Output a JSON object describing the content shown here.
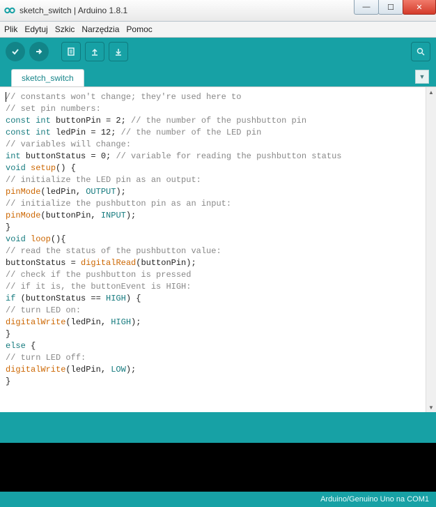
{
  "window": {
    "title": "sketch_switch | Arduino 1.8.1"
  },
  "menu": {
    "items": [
      "Plik",
      "Edytuj",
      "Szkic",
      "Narzędzia",
      "Pomoc"
    ]
  },
  "tab": {
    "name": "sketch_switch"
  },
  "code": {
    "lines": [
      {
        "t": "comment",
        "text": "// constants won't change; they're used here to"
      },
      {
        "t": "comment",
        "text": "// set pin numbers:"
      },
      {
        "t": "mixed",
        "parts": [
          {
            "c": "kw",
            "s": "const int"
          },
          {
            "c": "",
            "s": " buttonPin = 2; "
          },
          {
            "c": "comment",
            "s": "// the number of the pushbutton pin"
          }
        ]
      },
      {
        "t": "mixed",
        "parts": [
          {
            "c": "kw",
            "s": "const int"
          },
          {
            "c": "",
            "s": " ledPin = 12; "
          },
          {
            "c": "comment",
            "s": "// the number of the LED pin"
          }
        ]
      },
      {
        "t": "comment",
        "text": "// variables will change:"
      },
      {
        "t": "mixed",
        "parts": [
          {
            "c": "kw",
            "s": "int"
          },
          {
            "c": "",
            "s": " buttonStatus = 0; "
          },
          {
            "c": "comment",
            "s": "// variable for reading the pushbutton status"
          }
        ]
      },
      {
        "t": "mixed",
        "parts": [
          {
            "c": "kw",
            "s": "void"
          },
          {
            "c": "",
            "s": " "
          },
          {
            "c": "func",
            "s": "setup"
          },
          {
            "c": "",
            "s": "() {"
          }
        ]
      },
      {
        "t": "comment",
        "text": "// initialize the LED pin as an output:"
      },
      {
        "t": "mixed",
        "parts": [
          {
            "c": "func",
            "s": "pinMode"
          },
          {
            "c": "",
            "s": "(ledPin, "
          },
          {
            "c": "const",
            "s": "OUTPUT"
          },
          {
            "c": "",
            "s": ");"
          }
        ]
      },
      {
        "t": "comment",
        "text": "// initialize the pushbutton pin as an input:"
      },
      {
        "t": "mixed",
        "parts": [
          {
            "c": "func",
            "s": "pinMode"
          },
          {
            "c": "",
            "s": "(buttonPin, "
          },
          {
            "c": "const",
            "s": "INPUT"
          },
          {
            "c": "",
            "s": ");"
          }
        ]
      },
      {
        "t": "plain",
        "text": "}"
      },
      {
        "t": "mixed",
        "parts": [
          {
            "c": "kw",
            "s": "void"
          },
          {
            "c": "",
            "s": " "
          },
          {
            "c": "func",
            "s": "loop"
          },
          {
            "c": "",
            "s": "(){"
          }
        ]
      },
      {
        "t": "comment",
        "text": "// read the status of the pushbutton value:"
      },
      {
        "t": "mixed",
        "parts": [
          {
            "c": "",
            "s": "buttonStatus = "
          },
          {
            "c": "func",
            "s": "digitalRead"
          },
          {
            "c": "",
            "s": "(buttonPin);"
          }
        ]
      },
      {
        "t": "comment",
        "text": "// check if the pushbutton is pressed"
      },
      {
        "t": "comment",
        "text": "// if it is, the buttonEvent is HIGH:"
      },
      {
        "t": "mixed",
        "parts": [
          {
            "c": "kw",
            "s": "if"
          },
          {
            "c": "",
            "s": " (buttonStatus == "
          },
          {
            "c": "const",
            "s": "HIGH"
          },
          {
            "c": "",
            "s": ") {"
          }
        ]
      },
      {
        "t": "comment",
        "text": "// turn LED on:"
      },
      {
        "t": "mixed",
        "parts": [
          {
            "c": "func",
            "s": "digitalWrite"
          },
          {
            "c": "",
            "s": "(ledPin, "
          },
          {
            "c": "const",
            "s": "HIGH"
          },
          {
            "c": "",
            "s": ");"
          }
        ]
      },
      {
        "t": "plain",
        "text": "}"
      },
      {
        "t": "mixed",
        "parts": [
          {
            "c": "kw",
            "s": "else"
          },
          {
            "c": "",
            "s": " {"
          }
        ]
      },
      {
        "t": "comment",
        "text": "// turn LED off:"
      },
      {
        "t": "mixed",
        "parts": [
          {
            "c": "func",
            "s": "digitalWrite"
          },
          {
            "c": "",
            "s": "(ledPin, "
          },
          {
            "c": "const",
            "s": "LOW"
          },
          {
            "c": "",
            "s": ");"
          }
        ]
      },
      {
        "t": "plain",
        "text": "}"
      }
    ]
  },
  "status": {
    "board": "Arduino/Genuino Uno na COM1"
  }
}
